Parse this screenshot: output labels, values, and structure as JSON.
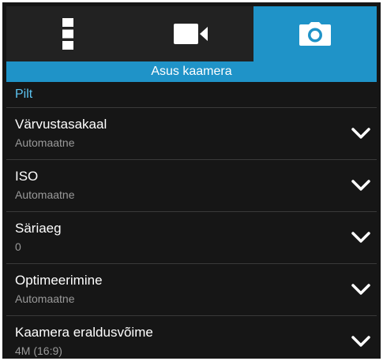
{
  "tabs": [
    {
      "icon": "more-options-icon",
      "active": false
    },
    {
      "icon": "video-camera-icon",
      "active": false
    },
    {
      "icon": "camera-icon",
      "active": true
    }
  ],
  "header": {
    "title": "Asus kaamera"
  },
  "section": {
    "label": "Pilt"
  },
  "settings": [
    {
      "title": "Värvustasakaal",
      "value": "Automaatne"
    },
    {
      "title": "ISO",
      "value": "Automaatne"
    },
    {
      "title": "Säriaeg",
      "value": "0"
    },
    {
      "title": "Optimeerimine",
      "value": "Automaatne"
    },
    {
      "title": "Kaamera eraldusvõime",
      "value": "4M (16:9)"
    }
  ],
  "colors": {
    "accent": "#1f93c8",
    "section_label": "#5cc3f0",
    "background": "#161616",
    "tabbar": "#222222"
  }
}
